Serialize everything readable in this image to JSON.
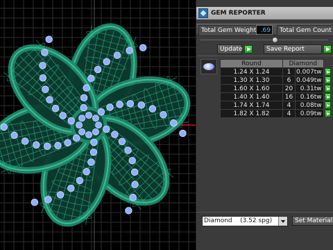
{
  "viewport": {
    "grid_color": "#2f2f2f",
    "axis_color": "#d11",
    "model_color": "#1d8a6a",
    "gem_color": "#8fb0ff"
  },
  "panel": {
    "title": "GEM REPORTER",
    "total_gem_weight_label": "Total Gem Weight",
    "total_gem_weight_value": ".69",
    "total_gem_count_label": "Total Gem Count",
    "update_label": "Update",
    "save_report_label": "Save Report",
    "table": {
      "headers": [
        "Round",
        "Diamond"
      ],
      "rows": [
        {
          "size": "1.24 X 1.24",
          "count": "1",
          "weight": "0.007tw"
        },
        {
          "size": "1.30 X 1.30",
          "count": "6",
          "weight": "0.049tw"
        },
        {
          "size": "1.60 X 1.60",
          "count": "20",
          "weight": "0.31tw"
        },
        {
          "size": "1.40 X 1.40",
          "count": "16",
          "weight": "0.16tw"
        },
        {
          "size": "1.74 X 1.74",
          "count": "4",
          "weight": "0.08tw"
        },
        {
          "size": "1.82 X 1.82",
          "count": "4",
          "weight": "0.09tw"
        }
      ]
    },
    "material_select_value": "Diamond    (3.52 spg)",
    "set_material_label": "Set Material"
  }
}
